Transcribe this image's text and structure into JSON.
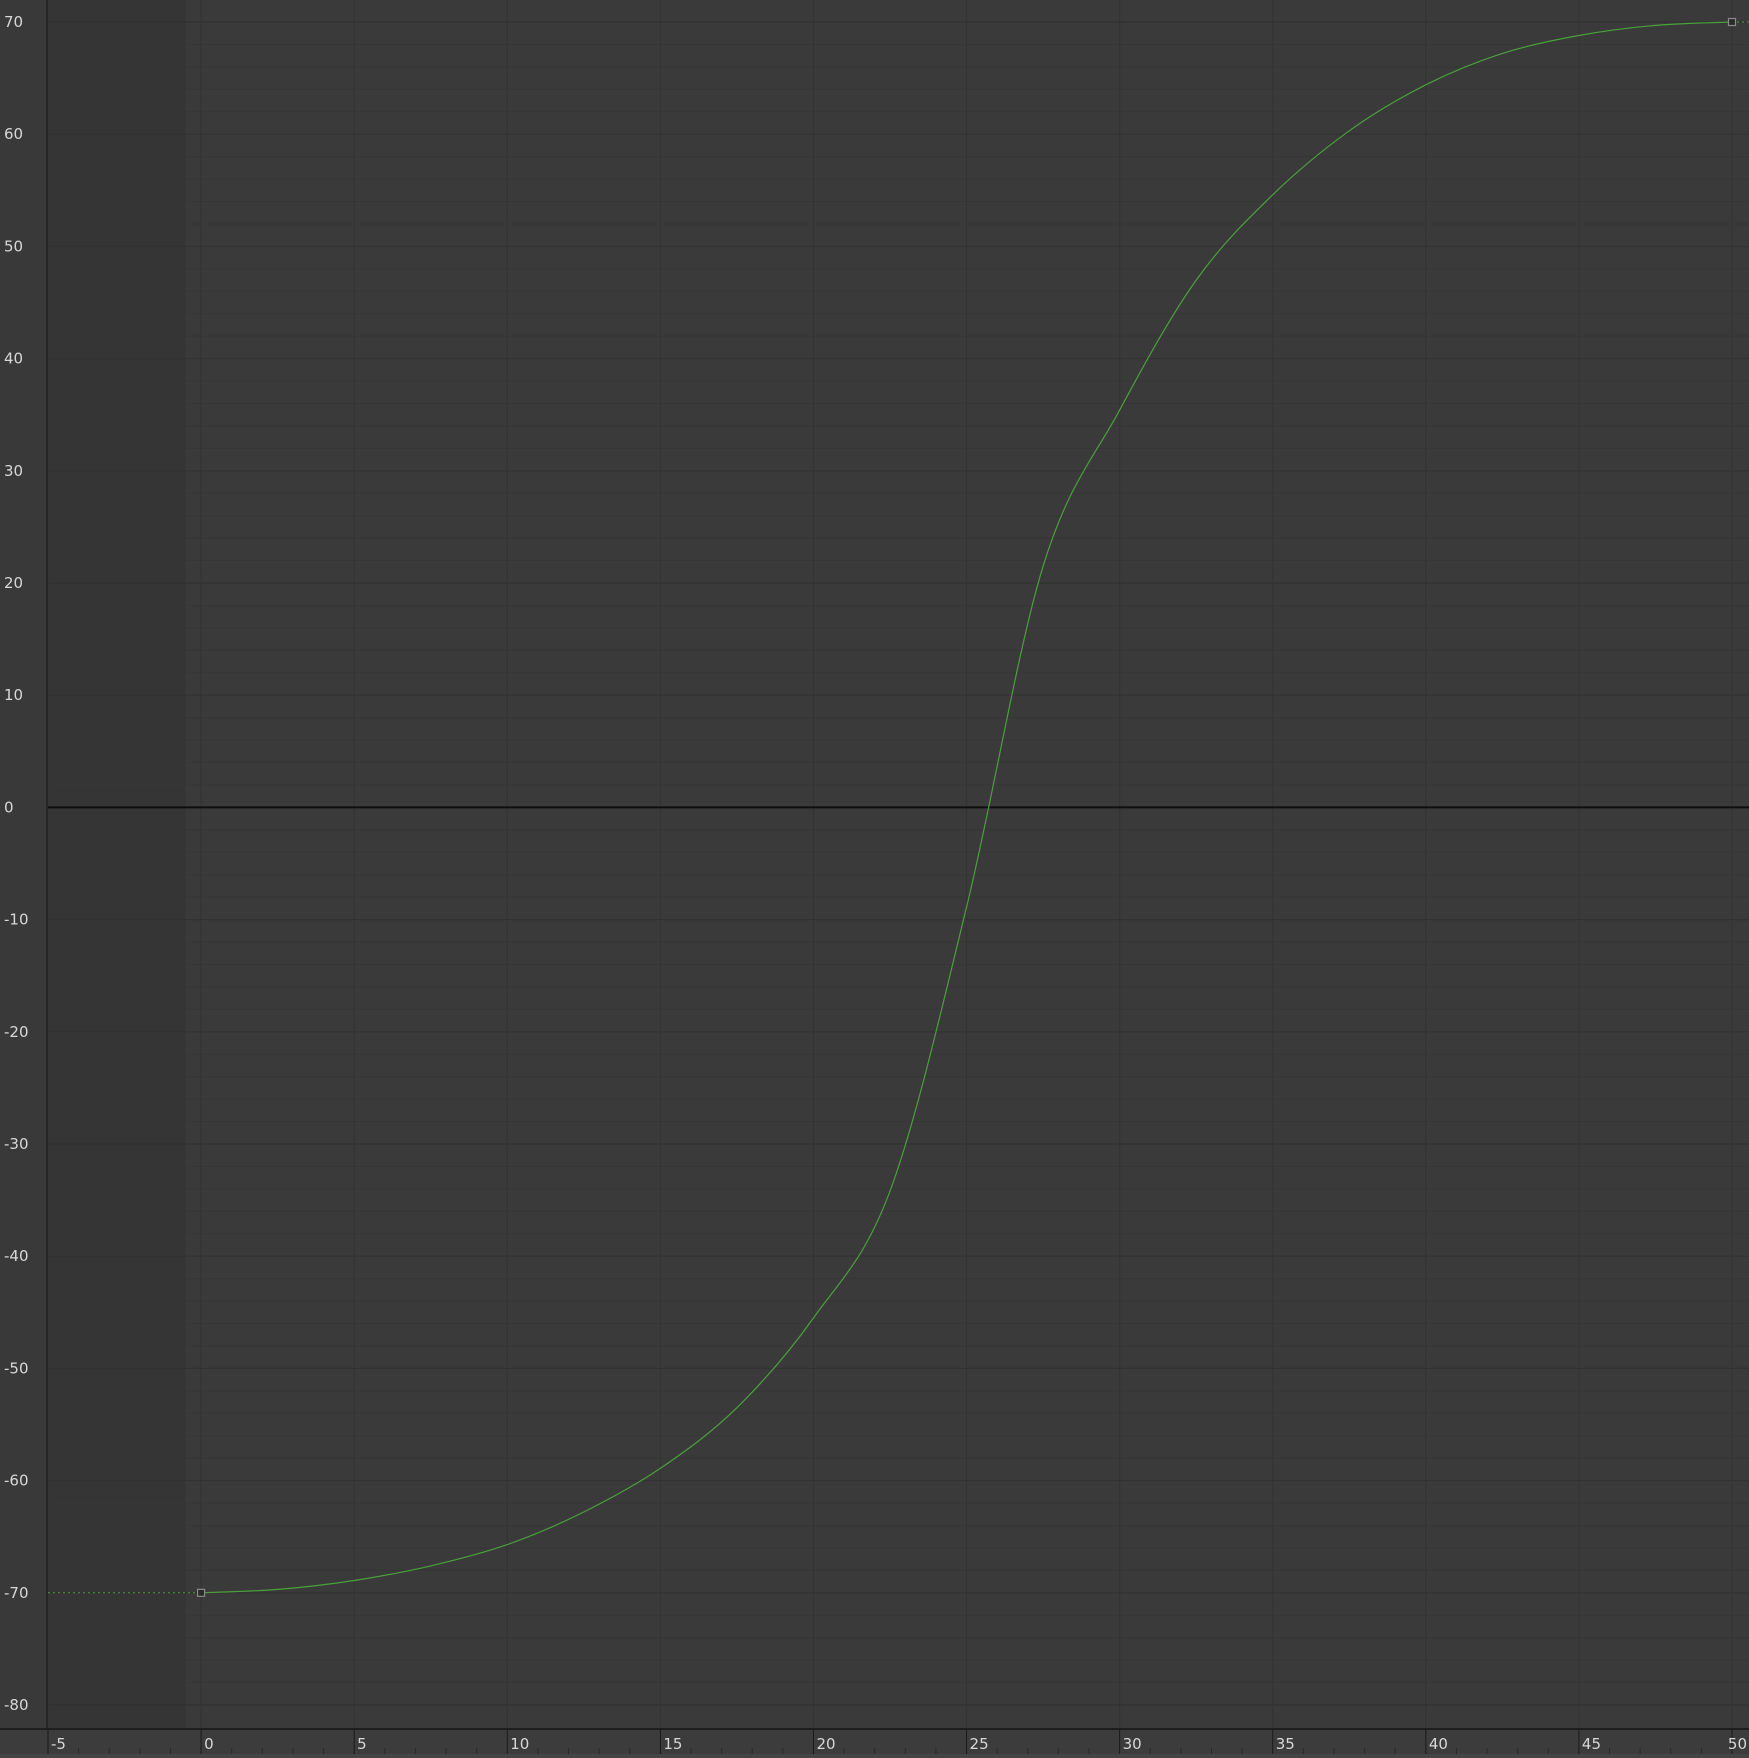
{
  "editor": {
    "background_color": "#3a3a3a",
    "inactive_region_color": "#353535",
    "curve_color": "#4aa03c",
    "zero_line_color": "#0e0e0e",
    "key_color": "#8a8a8a"
  },
  "chart_data": {
    "type": "line",
    "title": "",
    "xlabel": "",
    "ylabel": "",
    "xlim": [
      -5,
      50
    ],
    "ylim": [
      -80,
      70
    ],
    "x_ticks": [
      -5,
      0,
      5,
      10,
      15,
      20,
      25,
      30,
      35,
      40,
      45,
      50
    ],
    "y_ticks": [
      70,
      60,
      50,
      40,
      30,
      20,
      10,
      0,
      -10,
      -20,
      -30,
      -40,
      -50,
      -60,
      -70,
      -80
    ],
    "x_tick_labels": [
      "-5",
      "0",
      "5",
      "10",
      "15",
      "20",
      "25",
      "30",
      "35",
      "40",
      "45",
      "50"
    ],
    "y_tick_labels": [
      "70",
      "60",
      "50",
      "40",
      "30",
      "20",
      "10",
      "0",
      "-10",
      "-20",
      "-30",
      "-40",
      "-50",
      "-60",
      "-70",
      "-80"
    ],
    "grid": true,
    "active_range_start": -0.5,
    "keyframes": [
      {
        "x": 0,
        "y": -70
      },
      {
        "x": 50,
        "y": 70
      }
    ],
    "series": [
      {
        "x": [
          0,
          2.5,
          5,
          7.5,
          10,
          12.5,
          15,
          17.5,
          20,
          22.5,
          25,
          27.5,
          30,
          32.5,
          35,
          37.5,
          40,
          42.5,
          45,
          47.5,
          50
        ],
        "y": [
          -70,
          -69.7,
          -68.9,
          -67.6,
          -65.7,
          -62.8,
          -58.9,
          -53.5,
          -45.5,
          -34.2,
          -8.9,
          21.5,
          35.4,
          47.0,
          54.6,
          60.3,
          64.4,
          67.2,
          68.8,
          69.7,
          70
        ]
      }
    ]
  }
}
